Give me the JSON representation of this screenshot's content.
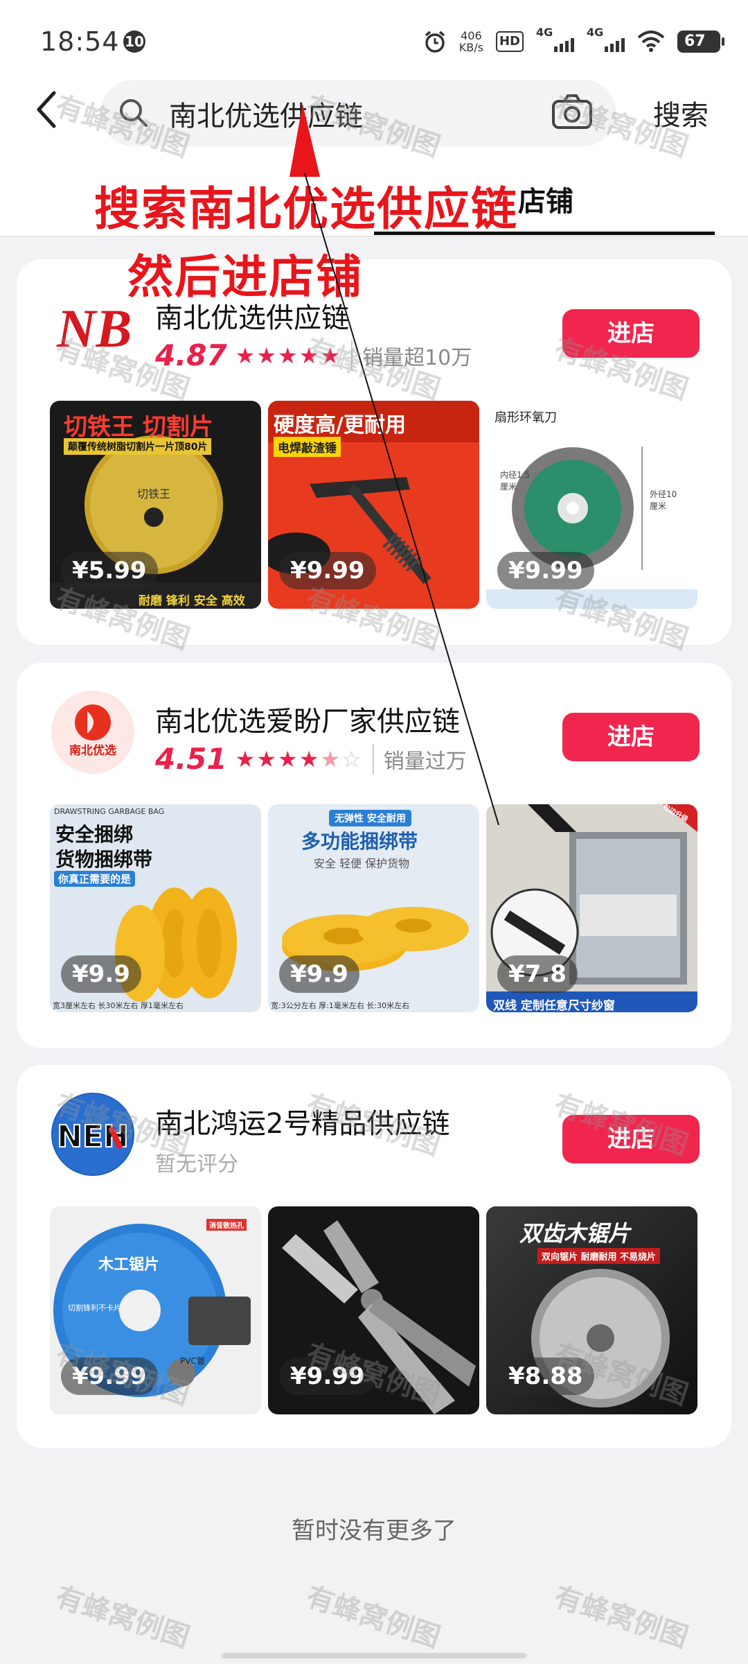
{
  "status_bar": {
    "time": "18:54",
    "notification_count": "10",
    "net_speed_value": "406",
    "net_speed_unit": "KB/s",
    "hd_label": "HD",
    "signal_1": "4G",
    "signal_2": "4G",
    "battery": "67"
  },
  "search": {
    "query": "南北优选供应链",
    "submit_label": "搜索"
  },
  "tabs": {
    "shop_tab": "店铺"
  },
  "annotations": {
    "line_1": "搜索南北优选供应链",
    "line_2": "然后进店铺",
    "color": "#e8151b"
  },
  "shops": [
    {
      "name": "南北优选供应链",
      "rating": "4.87",
      "stars": "★★★★★",
      "sales": "销量超10万",
      "enter_label": "进店",
      "logo_text": "NB",
      "products": [
        {
          "price": "¥5.99",
          "caption_top": "切铁王 切割片",
          "caption_sub": "颠覆传统树脂切割片一片顶80片",
          "caption_bottom": "耐磨 锋利 安全 高效",
          "wheel_label": "切铁王"
        },
        {
          "price": "¥9.99",
          "caption_top": "硬度高/更耐用",
          "caption_sub": "电焊敲渣锤"
        },
        {
          "price": "¥9.99",
          "caption_top": "扇形环氧刀",
          "caption_sub": "外径10厘米",
          "caption_sub2": "内径1.5厘米"
        }
      ]
    },
    {
      "name": "南北优选爱盼厂家供应链",
      "rating": "4.51",
      "stars": "★★★★",
      "stars_half": "★",
      "stars_empty": "☆",
      "sales": "销量过万",
      "enter_label": "进店",
      "logo_text": "南北优选",
      "products": [
        {
          "price": "¥9.9",
          "caption_top": "DRAWSTRING GARBAGE BAG",
          "caption_mid": "安全捆绑",
          "caption_mid2": "货物捆绑带",
          "caption_sub": "你真正需要的是",
          "caption_bottom": "宽3厘米左右 长30米左右 厚1毫米左右"
        },
        {
          "price": "¥9.9",
          "caption_top": "无弹性 安全耐用",
          "caption_mid": "多功能捆绑带",
          "caption_sub": "安全 轻便 保护货物",
          "caption_bottom": "宽:3公分左右 厚:1毫米左右 长:30米左右"
        },
        {
          "price": "¥7.8",
          "caption_bottom": "双线 定制任意尺寸纱窗",
          "corner_badge": "包边升级"
        }
      ]
    },
    {
      "name": "南北鸿运2号精品供应链",
      "no_rating": "暂无评分",
      "enter_label": "进店",
      "logo_text": "NEH",
      "products": [
        {
          "price": "¥9.99",
          "caption_top": "木工锯片",
          "caption_badge": "消音散热孔",
          "caption_sub": "切割锋利不卡片",
          "caption_sub2": "PVC管"
        },
        {
          "price": "¥9.99"
        },
        {
          "price": "¥8.88",
          "caption_top": "双齿木锯片",
          "caption_sub": "双向锯片 耐磨耐用 不易烧片"
        }
      ]
    }
  ],
  "footer": {
    "no_more": "暂时没有更多了"
  },
  "watermark_text": "有蜂窝例图"
}
